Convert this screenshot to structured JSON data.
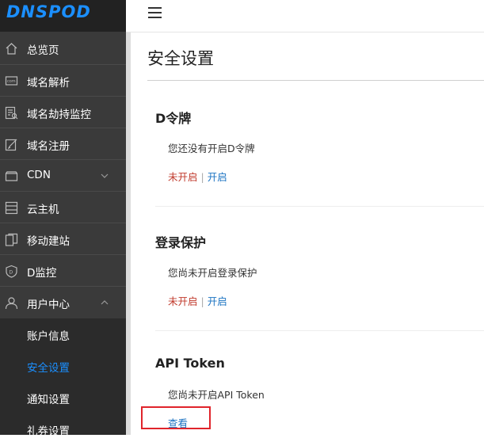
{
  "brand": {
    "logo_text": "DNSPOD",
    "accent": "#1b8fff"
  },
  "sidebar": {
    "items": [
      {
        "label": "总览页",
        "icon": "home-icon"
      },
      {
        "label": "域名解析",
        "icon": "dns-icon"
      },
      {
        "label": "域名劫持监控",
        "icon": "monitor-list-icon"
      },
      {
        "label": "域名注册",
        "icon": "edit-icon"
      },
      {
        "label": "CDN",
        "icon": "cloud-icon",
        "expandable": true
      },
      {
        "label": "云主机",
        "icon": "server-icon"
      },
      {
        "label": "移动建站",
        "icon": "mobile-site-icon"
      },
      {
        "label": "D监控",
        "icon": "shield-icon"
      },
      {
        "label": "用户中心",
        "icon": "user-icon",
        "expanded": true
      }
    ],
    "submenu": [
      {
        "label": "账户信息"
      },
      {
        "label": "安全设置",
        "active": true
      },
      {
        "label": "通知设置"
      },
      {
        "label": "礼券设置"
      }
    ]
  },
  "main": {
    "title": "安全设置",
    "sections": [
      {
        "title": "D令牌",
        "desc": "您还没有开启D令牌",
        "status": "未开启",
        "action": "开启"
      },
      {
        "title": "登录保护",
        "desc": "您尚未开启登录保护",
        "status": "未开启",
        "action": "开启"
      },
      {
        "title": "API Token",
        "desc": "您尚未开启API Token",
        "action": "查看"
      }
    ]
  },
  "colors": {
    "sidebar_bg": "#3a3a3a",
    "link": "#1b73c2",
    "status_off": "#c0392b",
    "highlight_box": "#e0242b"
  }
}
